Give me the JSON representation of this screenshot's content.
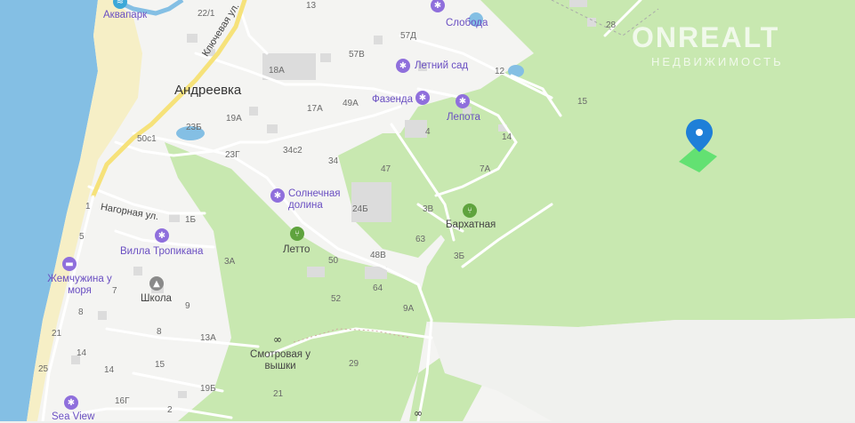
{
  "places": {
    "andreevka": "Андреевка"
  },
  "streets": {
    "klyuchevaya": "Ключевая ул.",
    "nagornaya": "Нагорная ул."
  },
  "pois": {
    "akvapark": "Аквапарк",
    "sloboda": "Слобода",
    "letniy_sad": "Летний сад",
    "fazenda": "Фазенда",
    "lepota": "Лепота",
    "solnechnaya_dolina": "Солнечная долина",
    "barkhatnaya": "Бархатная",
    "villa_tropikana": "Вилла Тропикана",
    "letto": "Летто",
    "zhemchuzhina": "Жемчужина у моря",
    "shkola": "Школа",
    "smotrovaya": "Смотровая у вышки",
    "sea_view": "Sea View"
  },
  "house_numbers": {
    "h22_1": "22/1",
    "h13": "13",
    "h57d": "57Д",
    "h28": "28",
    "h57v": "57В",
    "h12": "12",
    "h18a": "18А",
    "h15": "15",
    "h17a": "17А",
    "h49a": "49А",
    "h19a": "19А",
    "h23b": "23Б",
    "h4": "4",
    "h14": "14",
    "h50c1": "50с1",
    "h34c2": "34с2",
    "h23g": "23Г",
    "h34": "34",
    "h47": "47",
    "h7a": "7А",
    "h1": "1",
    "h1b": "1Б",
    "h24b": "24Б",
    "h3v": "3В",
    "h63": "63",
    "h5": "5",
    "h3b": "3Б",
    "h3a": "3А",
    "h48v": "48В",
    "h50": "50",
    "h64": "64",
    "h7": "7",
    "h9": "9",
    "h52": "52",
    "h9a": "9А",
    "h8": "8",
    "h21a": "21",
    "h8b": "8",
    "h13a": "13А",
    "h14b": "14",
    "h25": "25",
    "h14c": "14",
    "h15b": "15",
    "h29": "29",
    "h19b": "19Б",
    "h21b": "21",
    "h16g": "16Г",
    "h2": "2"
  },
  "watermark": {
    "brand": "ONREALT",
    "sub": "НЕДВИЖИМОСТЬ"
  },
  "icons": {
    "marker": "map-pin-icon",
    "poi": "palm-tree-icon",
    "hotel": "bed-icon",
    "school": "graduation-cap-icon",
    "viewpoint": "binoculars-icon",
    "restaurant": "fork-knife-icon"
  },
  "colors": {
    "sea": "#84bfe4",
    "beach": "#f7efc8",
    "forest": "#c9e9b2",
    "urban": "#f2f2f0",
    "pin": "#1e7fd8",
    "plot": "#58e06b"
  }
}
